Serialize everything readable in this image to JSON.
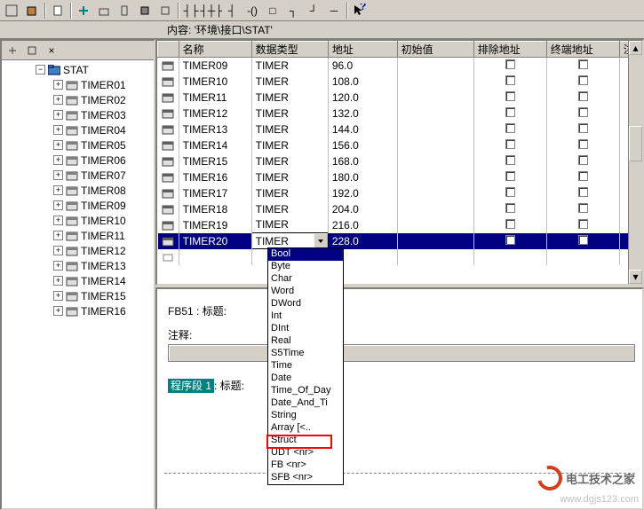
{
  "path_bar": {
    "label": "内容:",
    "value": "'环境\\接口\\STAT'"
  },
  "tree": {
    "root": "STAT",
    "items": [
      "TIMER01",
      "TIMER02",
      "TIMER03",
      "TIMER04",
      "TIMER05",
      "TIMER06",
      "TIMER07",
      "TIMER08",
      "TIMER09",
      "TIMER10",
      "TIMER11",
      "TIMER12",
      "TIMER13",
      "TIMER14",
      "TIMER15",
      "TIMER16"
    ]
  },
  "table": {
    "headers": {
      "name": "名称",
      "type": "数据类型",
      "addr": "地址",
      "init": "初始值",
      "excl": "排除地址",
      "term": "终端地址",
      "note": "注"
    },
    "rows": [
      {
        "name": "TIMER09",
        "type": "TIMER",
        "addr": "96.0"
      },
      {
        "name": "TIMER10",
        "type": "TIMER",
        "addr": "108.0"
      },
      {
        "name": "TIMER11",
        "type": "TIMER",
        "addr": "120.0"
      },
      {
        "name": "TIMER12",
        "type": "TIMER",
        "addr": "132.0"
      },
      {
        "name": "TIMER13",
        "type": "TIMER",
        "addr": "144.0"
      },
      {
        "name": "TIMER14",
        "type": "TIMER",
        "addr": "156.0"
      },
      {
        "name": "TIMER15",
        "type": "TIMER",
        "addr": "168.0"
      },
      {
        "name": "TIMER16",
        "type": "TIMER",
        "addr": "180.0"
      },
      {
        "name": "TIMER17",
        "type": "TIMER",
        "addr": "192.0"
      },
      {
        "name": "TIMER18",
        "type": "TIMER",
        "addr": "204.0"
      },
      {
        "name": "TIMER19",
        "type": "TIMER",
        "addr": "216.0"
      },
      {
        "name": "TIMER20",
        "type": "TIMER",
        "addr": "228.0",
        "selected": true
      }
    ]
  },
  "dropdown": {
    "options": [
      "Bool",
      "Byte",
      "Char",
      "Word",
      "DWord",
      "Int",
      "DInt",
      "Real",
      "S5Time",
      "Time",
      "Date",
      "Time_Of_Day",
      "Date_And_Ti",
      "String",
      "Array [<..",
      "Struct",
      "UDT <nr>",
      "FB <nr>",
      "SFB <nr>"
    ],
    "selected": "Bool",
    "highlighted": "FB <nr>"
  },
  "editor": {
    "fb_label": "FB51 : 标题:",
    "comment_label": "注释:",
    "segment_tag": "程序段 1",
    "segment_suffix": ": 标题:"
  },
  "watermark": {
    "text": "电工技术之家",
    "url": "www.dgjs123.com"
  }
}
